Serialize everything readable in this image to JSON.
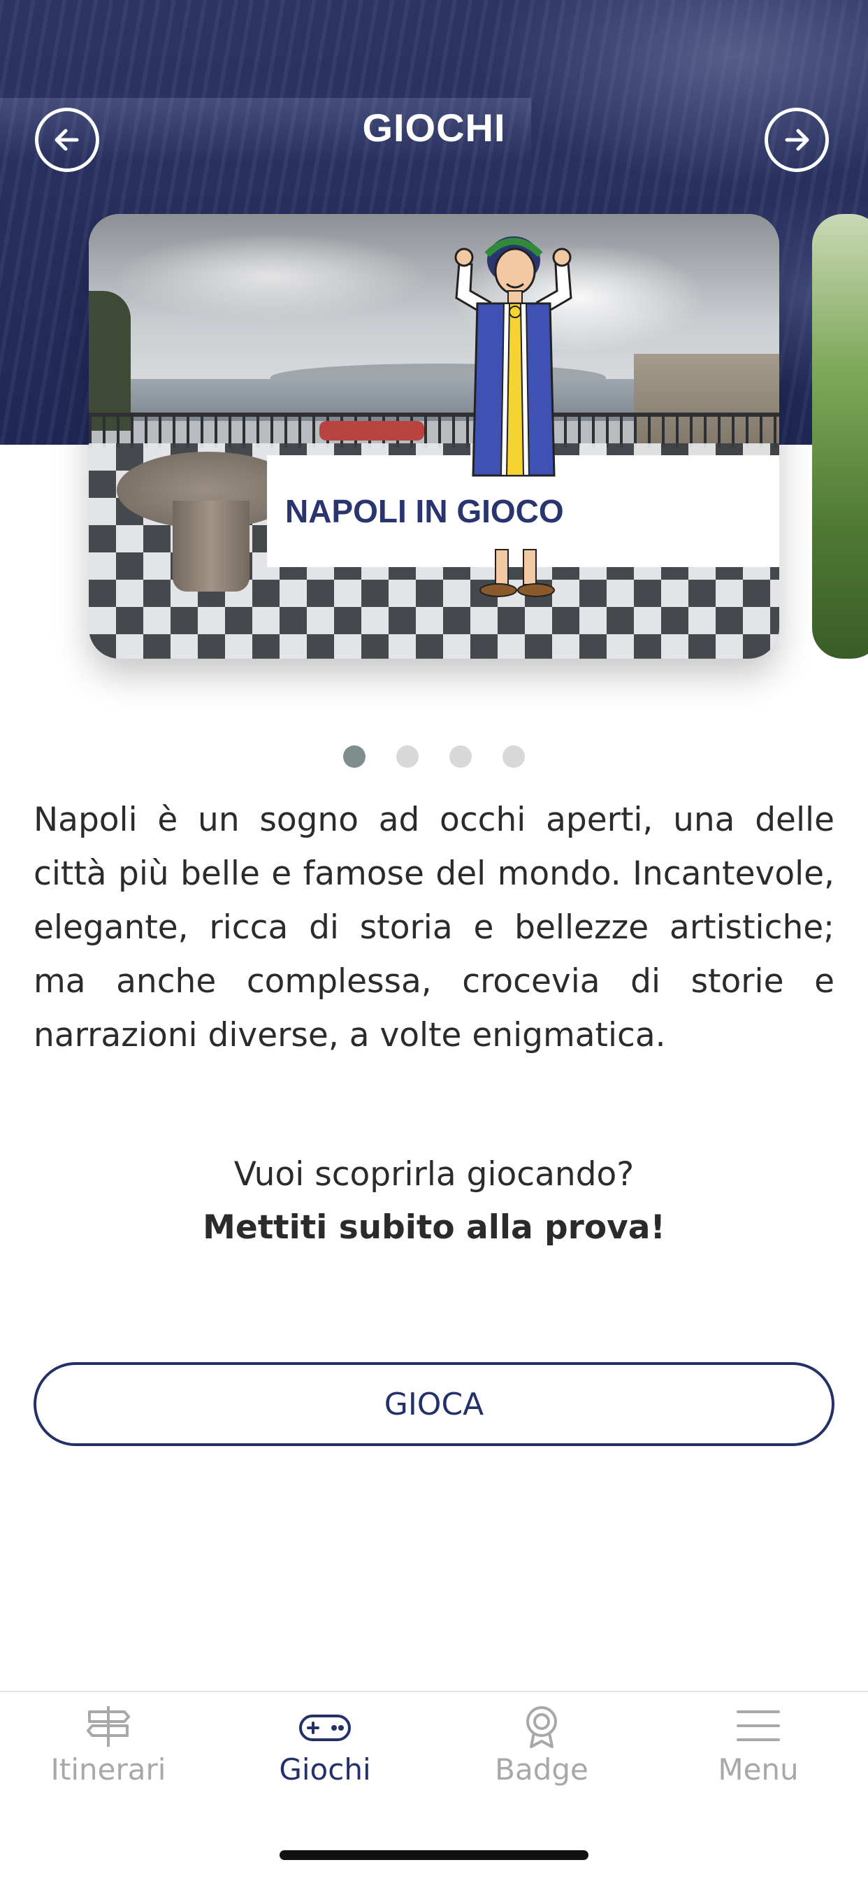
{
  "header": {
    "title": "GIOCHI",
    "back_icon": "arrow-left-circle-icon",
    "forward_icon": "arrow-right-circle-icon"
  },
  "carousel": {
    "cards": [
      {
        "title": "NAPOLI IN GIOCO"
      }
    ],
    "page_count": 4,
    "active_index": 0
  },
  "content": {
    "description": "Napoli è un sogno ad occhi aperti, una delle città più belle e famose del mondo. Incantevole, elegante, ricca di storia e bellezze artistiche; ma anche complessa, crocevia di storie e narrazioni diverse, a volte enigmatica.",
    "question": "Vuoi scoprirla giocando?",
    "call_to_action": "Mettiti subito alla prova!",
    "play_button_label": "GIOCA"
  },
  "tab_bar": {
    "items": [
      {
        "label": "Itinerari",
        "icon": "signpost-icon",
        "active": false
      },
      {
        "label": "Giochi",
        "icon": "gamepad-icon",
        "active": true
      },
      {
        "label": "Badge",
        "icon": "badge-icon",
        "active": false
      },
      {
        "label": "Menu",
        "icon": "menu-icon",
        "active": false
      }
    ]
  },
  "colors": {
    "primary": "#23306a",
    "inactive_tab": "#a8a8a8",
    "active_dot": "#7d8e8c",
    "inactive_dot": "#d8d8d8"
  }
}
